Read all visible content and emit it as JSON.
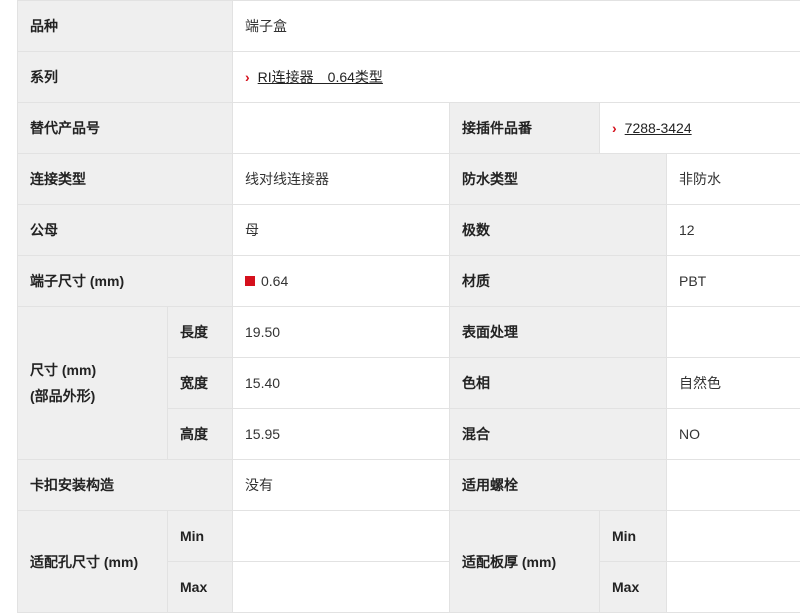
{
  "rows": {
    "variety": {
      "label": "品种",
      "value": "端子盒"
    },
    "series": {
      "label": "系列",
      "value": "RI连接器　0.64类型"
    },
    "replacement": {
      "label": "替代产品号",
      "value": ""
    },
    "mating": {
      "label": "接插件品番",
      "value": "7288-3424"
    },
    "connection_type": {
      "label": "连接类型",
      "value": "线对线连接器"
    },
    "waterproof_type": {
      "label": "防水类型",
      "value": "非防水"
    },
    "gender": {
      "label": "公母",
      "value": "母"
    },
    "poles": {
      "label": "极数",
      "value": "12"
    },
    "terminal_size": {
      "label": "端子尺寸 (mm)",
      "value": "0.64"
    },
    "material": {
      "label": "材质",
      "value": "PBT"
    },
    "dimensions": {
      "label_line1": "尺寸 (mm)",
      "label_line2": "(部品外形)",
      "length": {
        "label": "長度",
        "value": "19.50"
      },
      "width": {
        "label": "宽度",
        "value": "15.40"
      },
      "height": {
        "label": "高度",
        "value": "15.95"
      }
    },
    "surface_treatment": {
      "label": "表面处理",
      "value": ""
    },
    "color": {
      "label": "色相",
      "value": "自然色"
    },
    "mixing": {
      "label": "混合",
      "value": "NO"
    },
    "clip_structure": {
      "label": "卡扣安装构造",
      "value": "没有"
    },
    "bolt": {
      "label": "适用螺栓",
      "value": ""
    },
    "hole_size": {
      "label": "适配孔尺寸 (mm)",
      "min": {
        "label": "Min",
        "value": ""
      },
      "max": {
        "label": "Max",
        "value": ""
      }
    },
    "plate_thickness": {
      "label": "适配板厚 (mm)",
      "min": {
        "label": "Min",
        "value": ""
      },
      "max": {
        "label": "Max",
        "value": ""
      }
    }
  },
  "colors": {
    "accent": "#d5101c",
    "label_bg": "#efefef",
    "border": "#e2e2e2"
  },
  "icons": {
    "link_marker": "chevron-right-icon",
    "terminal_marker": "red-square-icon"
  }
}
